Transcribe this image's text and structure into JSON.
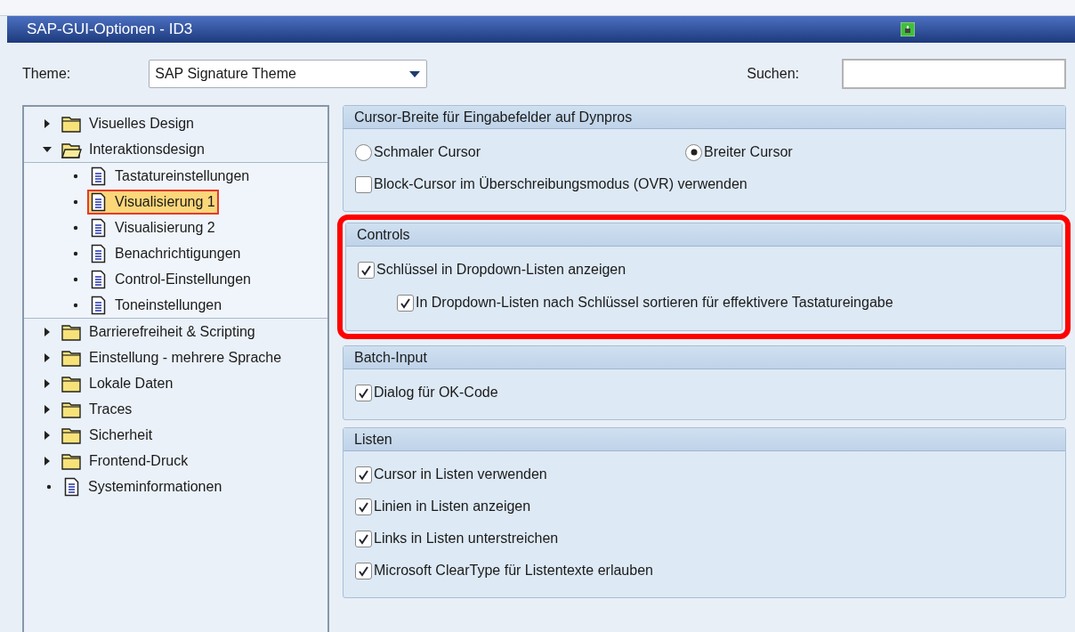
{
  "window": {
    "title": "SAP-GUI-Optionen - ID3"
  },
  "theme": {
    "label": "Theme:",
    "value": "SAP Signature Theme"
  },
  "search": {
    "label": "Suchen:"
  },
  "tree": [
    {
      "kind": "folder",
      "label": "Visuelles Design",
      "expanded": false,
      "selected": false
    },
    {
      "kind": "folder",
      "label": "Interaktionsdesign",
      "expanded": true,
      "selected": false,
      "children": [
        {
          "kind": "page",
          "label": "Tastatureinstellungen",
          "selected": false
        },
        {
          "kind": "page",
          "label": "Visualisierung 1",
          "selected": true
        },
        {
          "kind": "page",
          "label": "Visualisierung 2",
          "selected": false
        },
        {
          "kind": "page",
          "label": "Benachrichtigungen",
          "selected": false
        },
        {
          "kind": "page",
          "label": "Control-Einstellungen",
          "selected": false
        },
        {
          "kind": "page",
          "label": "Toneinstellungen",
          "selected": false
        }
      ]
    },
    {
      "kind": "folder",
      "label": "Barrierefreiheit & Scripting",
      "expanded": false,
      "selected": false
    },
    {
      "kind": "folder",
      "label": "Einstellung - mehrere Sprache",
      "expanded": false,
      "selected": false
    },
    {
      "kind": "folder",
      "label": "Lokale Daten",
      "expanded": false,
      "selected": false
    },
    {
      "kind": "folder",
      "label": "Traces",
      "expanded": false,
      "selected": false
    },
    {
      "kind": "folder",
      "label": "Sicherheit",
      "expanded": false,
      "selected": false
    },
    {
      "kind": "folder",
      "label": "Frontend-Druck",
      "expanded": false,
      "selected": false
    },
    {
      "kind": "page",
      "label": "Systeminformationen",
      "selected": false
    }
  ],
  "groups": [
    {
      "title": "Cursor-Breite für Eingabefelder auf Dynpros",
      "highlighted": false,
      "rows": [
        [
          {
            "kind": "radio",
            "label": "Schmaler Cursor",
            "selected": false
          },
          {
            "kind": "radio",
            "label": "Breiter Cursor",
            "selected": true
          }
        ],
        [
          {
            "kind": "checkbox",
            "label": "Block-Cursor im Überschreibungsmodus (OVR) verwenden",
            "checked": false
          }
        ]
      ]
    },
    {
      "title": "Controls",
      "highlighted": true,
      "rows": [
        [
          {
            "kind": "checkbox",
            "label": "Schlüssel in Dropdown-Listen anzeigen",
            "checked": true,
            "children": [
              {
                "kind": "checkbox",
                "label": "In Dropdown-Listen nach Schlüssel sortieren für effektivere Tastatureingabe",
                "checked": true
              }
            ]
          }
        ]
      ]
    },
    {
      "title": "Batch-Input",
      "highlighted": false,
      "rows": [
        [
          {
            "kind": "checkbox",
            "label": "Dialog für OK-Code",
            "checked": true
          }
        ]
      ]
    },
    {
      "title": "Listen",
      "highlighted": false,
      "rows": [
        [
          {
            "kind": "checkbox",
            "label": "Cursor in Listen verwenden",
            "checked": true
          }
        ],
        [
          {
            "kind": "checkbox",
            "label": "Linien in Listen anzeigen",
            "checked": true
          }
        ],
        [
          {
            "kind": "checkbox",
            "label": "Links in Listen unterstreichen",
            "checked": true
          }
        ],
        [
          {
            "kind": "checkbox",
            "label": "Microsoft ClearType für Listentexte erlauben",
            "checked": true
          }
        ]
      ]
    }
  ]
}
